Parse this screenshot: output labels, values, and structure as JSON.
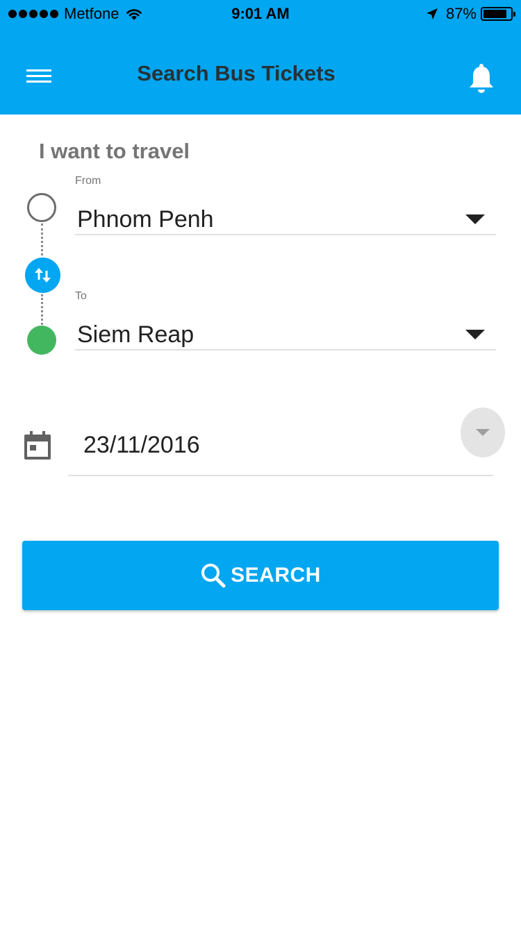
{
  "status_bar": {
    "carrier": "Metfone",
    "time": "9:01 AM",
    "battery_percent": "87%",
    "battery_level": 0.87,
    "icons": [
      "signal-dots-icon",
      "wifi-icon",
      "location-arrow-icon",
      "battery-icon"
    ]
  },
  "app_bar": {
    "title": "Search Bus Tickets",
    "icons": [
      "menu-icon",
      "bell-icon"
    ],
    "color": "#03a6f0"
  },
  "form": {
    "heading": "I want to travel",
    "from": {
      "label": "From",
      "value": "Phnom Penh"
    },
    "to": {
      "label": "To",
      "value": "Siem Reap"
    },
    "date": {
      "value": "23/11/2016"
    },
    "swap_icon": "swap-vertical-icon",
    "date_icon": "calendar-icon",
    "to_marker_color": "#43b760"
  },
  "search_button": {
    "label": "SEARCH",
    "icon": "search-icon"
  }
}
